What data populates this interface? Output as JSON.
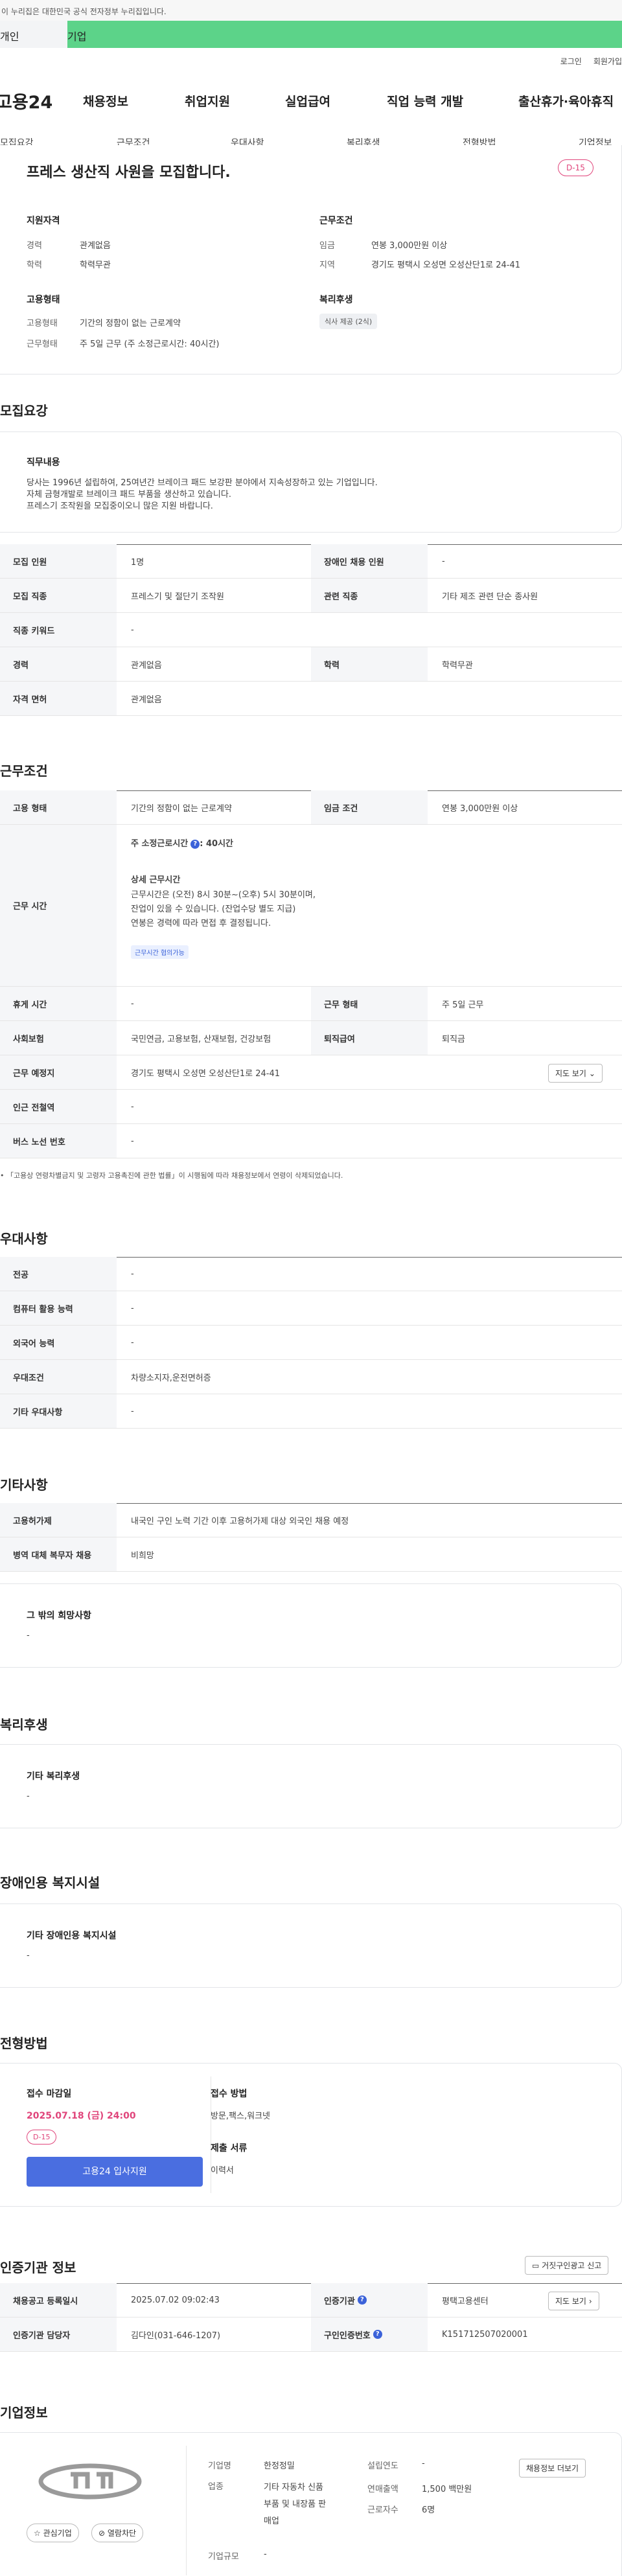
{
  "gov_banner": "이 누리집은 대한민국 공식 전자정부 누리집입니다.",
  "top_tabs": [
    "개인",
    "기업"
  ],
  "util": [
    "로그인",
    "회원가입"
  ],
  "logo": "고용24",
  "gnb": [
    "채용정보",
    "취업지원",
    "실업급여",
    "직업 능력 개발",
    "출산휴가·육아휴직"
  ],
  "snb": [
    "모집요강",
    "근무조건",
    "우대사항",
    "복리후생",
    "전형방법",
    "기업정보"
  ],
  "summary": {
    "title": "프레스 생산직 사원을 모집합니다.",
    "dday": "D-15",
    "qual_head": "지원자격",
    "career_l": "경력",
    "career_v": "관계없음",
    "edu_l": "학력",
    "edu_v": "학력무관",
    "cond_head": "근무조건",
    "wage_l": "임금",
    "wage_v": "연봉 3,000만원 이상",
    "area_l": "지역",
    "area_v": "경기도 평택시 오성면 오성산단1로 24-41",
    "emp_head": "고용형태",
    "emptype_l": "고용형태",
    "emptype_v": "기간의 정함이 없는 근로계약",
    "worktype_l": "근무형태",
    "worktype_v": "주 5일 근무 (주 소정근로시간: 40시간)",
    "welfare_head": "복리후생",
    "welfare_tag": "식사 제공 (2식)"
  },
  "recruit": {
    "heading": "모집요강",
    "duty_head": "직무내용",
    "duty_lines": [
      "당사는 1996년 설립하여, 25여년간 브레이크 패드 보강판 분야에서 지속성장하고 있는 기업입니다.",
      "자체 금형개발로 브레이크 패드 부품을 생산하고 있습니다.",
      "프레스기 조작원을 모집중이오니 많은 지원 바랍니다."
    ],
    "rows": [
      [
        "모집 인원",
        "1명",
        "장애인 채용 인원",
        "-"
      ],
      [
        "모집 직종",
        "프레스기 및 절단기 조작원",
        "관련 직종",
        "기타 제조 관련 단순 종사원"
      ],
      [
        "직종 키워드",
        "-"
      ],
      [
        "경력",
        "관계없음",
        "학력",
        "학력무관"
      ],
      [
        "자격 면허",
        "관계없음"
      ]
    ]
  },
  "work": {
    "heading": "근무조건",
    "r1": [
      "고용 형태",
      "기간의 정함이 없는 근로계약",
      "임금 조건",
      "연봉 3,000만원 이상"
    ],
    "time_label": "근무 시간",
    "time_week": "주 소정근로시간",
    "time_week_v": ": 40시간",
    "detail_head": "상세 근무시간",
    "detail_lines": [
      "근무시간은 (오전) 8시 30분~(오후) 5시 30분이며,",
      "잔업이 있을 수 있습니다. (잔업수당 별도 지급)",
      "연봉은 경력에 따라 면접 후 결정됩니다."
    ],
    "flex_tag": "근무시간 협의가능",
    "r3": [
      "휴게 시간",
      "-",
      "근무 형태",
      "주 5일 근무"
    ],
    "r4": [
      "사회보험",
      "국민연금, 고용보험, 산재보험, 건강보험",
      "퇴직급여",
      "퇴직금"
    ],
    "r5": [
      "근무 예정지",
      "경기도 평택시 오성면 오성산단1로 24-41"
    ],
    "map_btn": "지도 보기",
    "r6": [
      "인근 전철역",
      "-"
    ],
    "r7": [
      "버스 노선 번호",
      "-"
    ],
    "note": "「고용상 연령차별금지 및 고령자 고용촉진에 관한 법률」이 시행됨에 따라 채용정보에서 연령이 삭제되었습니다."
  },
  "pref": {
    "heading": "우대사항",
    "rows": [
      [
        "전공",
        "-"
      ],
      [
        "컴퓨터 활용 능력",
        "-"
      ],
      [
        "외국어 능력",
        "-"
      ],
      [
        "우대조건",
        "차량소지자,운전면허증"
      ],
      [
        "기타 우대사항",
        "-"
      ]
    ]
  },
  "etc": {
    "heading": "기타사항",
    "rows": [
      [
        "고용허가제",
        "내국인 구인 노력 기간 이후 고용허가제 대상 외국인 채용 예정"
      ],
      [
        "병역 대체 복무자 채용",
        "비희망"
      ]
    ],
    "hope_head": "그 밖의 희망사항",
    "hope_v": "-"
  },
  "welfare": {
    "heading": "복리후생",
    "head": "기타 복리후생",
    "v": "-"
  },
  "disab": {
    "heading": "장애인용 복지시설",
    "head": "기타 장애인용 복지시설",
    "v": "-"
  },
  "selection": {
    "heading": "전형방법",
    "deadline_head": "접수 마감일",
    "deadline": "2025.07.18 (금) 24:00",
    "dday": "D-15",
    "apply_btn": "고용24 입사지원",
    "method_head": "접수 방법",
    "method_v": "방문,팩스,워크넷",
    "docs_head": "제출 서류",
    "docs_v": "이력서"
  },
  "agency": {
    "heading": "인증기관 정보",
    "report_btn": "거짓구인광고 신고",
    "r1": [
      "채용공고 등록일시",
      "2025.07.02 09:02:43",
      "인증기관",
      "평택고용센터"
    ],
    "map_btn": "지도 보기",
    "r2": [
      "인증기관 담당자",
      "김다인(031-646-1207)",
      "구인인증번호",
      "K151712507020001"
    ]
  },
  "company": {
    "heading": "기업정보",
    "fav_btn": "관심기업",
    "block_btn": "열람차단",
    "name_l": "기업명",
    "name_v": "한정정밀",
    "year_l": "설립연도",
    "year_v": "-",
    "ind_l": "업종",
    "ind_v": [
      "기타 자동차 신품",
      "부품 및 내장품 판",
      "매업"
    ],
    "sales_l": "연매출액",
    "sales_v": "1,500 백만원",
    "emp_l": "근로자수",
    "emp_v": "6명",
    "size_l": "기업규모",
    "size_v": "-",
    "more_btn": "채용정보 더보기"
  }
}
